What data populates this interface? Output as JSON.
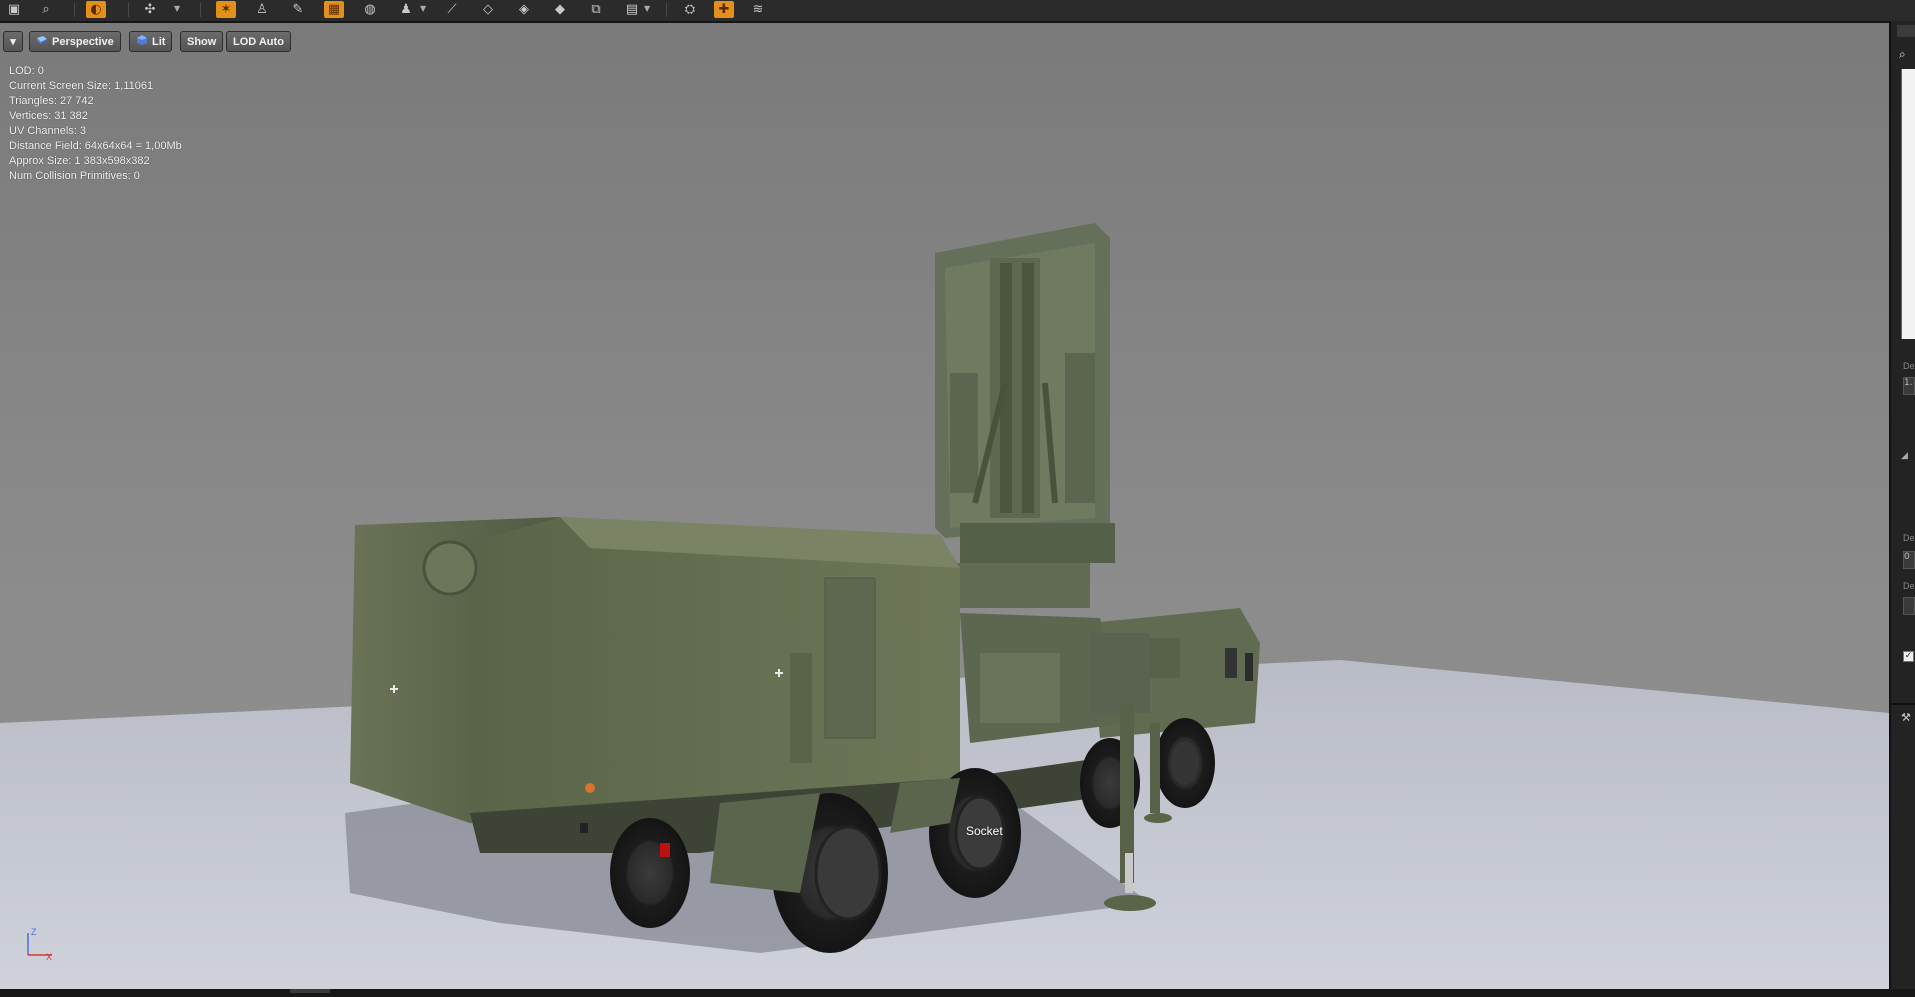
{
  "toolbar": {
    "icons": [
      "save-icon",
      "browse-icon",
      "reimport-icon",
      "collision-icon",
      "wireframe-icon",
      "normals-icon",
      "uv-icon",
      "grid-icon",
      "bounds-icon",
      "pivot-icon",
      "sockets-icon",
      "vertex-icon",
      "lod-icon",
      "simplify-icon",
      "copy-icon",
      "layers-icon",
      "settings-icon",
      "camera-icon",
      "toggle-icon",
      "stack-icon"
    ]
  },
  "viewport": {
    "buttons": {
      "menu_arrow": "▾",
      "perspective": "Perspective",
      "lit": "Lit",
      "show": "Show",
      "lod": "LOD Auto"
    },
    "stats": [
      "LOD:  0",
      "Current Screen Size:  1,11061",
      "Triangles:  27 742",
      "Vertices:  31 382",
      "UV Channels:  3",
      "Distance Field:  64x64x64 = 1,00Mb",
      "Approx Size: 1 383x598x382",
      "Num Collision Primitives:  0"
    ],
    "socket_label": "Socket",
    "axis": {
      "z": "Z",
      "x": "X"
    }
  },
  "right_panel": {
    "labels": [
      "De",
      "De",
      "De"
    ],
    "values": [
      "1.",
      "0",
      ""
    ]
  }
}
